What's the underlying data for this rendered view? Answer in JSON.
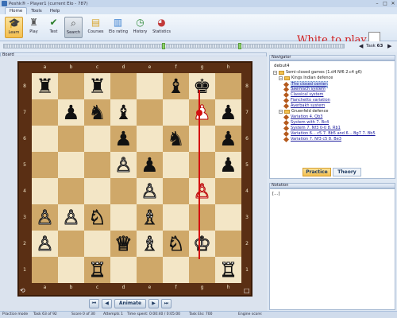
{
  "window": {
    "title": "Peshk® - Player1 (current Elo - 787)",
    "controls": [
      "–",
      "□",
      "✕"
    ]
  },
  "ribbon_tabs": [
    "Home",
    "Tools",
    "Help"
  ],
  "ribbon_buttons": [
    "Learn",
    "Play",
    "Test",
    "Search",
    "Courses",
    "Elo rating",
    "History",
    "Statistics"
  ],
  "turn_message": "White to play",
  "task": {
    "label": "Task",
    "number": "63"
  },
  "progress_nav": {
    "prev": "◀",
    "next": "▶"
  },
  "panels": {
    "board": "Board",
    "navigator": "Navigator",
    "notation": "Notation"
  },
  "board": {
    "files": [
      "a",
      "b",
      "c",
      "d",
      "e",
      "f",
      "g",
      "h"
    ],
    "ranks": [
      "8",
      "7",
      "6",
      "5",
      "4",
      "3",
      "2",
      "1"
    ],
    "pieces": [
      [
        "♜",
        "",
        "♜",
        "",
        "",
        "♝",
        "♚",
        ""
      ],
      [
        "",
        "♟",
        "♞",
        "♝",
        "",
        "",
        "♟",
        "♟"
      ],
      [
        "",
        "",
        "",
        "♟",
        "",
        "♞",
        "",
        "♟"
      ],
      [
        "",
        "",
        "",
        "♙",
        "♟",
        "",
        "",
        "♟"
      ],
      [
        "",
        "",
        "",
        "",
        "♙",
        "",
        "♙",
        ""
      ],
      [
        "♙",
        "♙",
        "♘",
        "",
        "♗",
        "",
        "",
        ""
      ],
      [
        "♙",
        "",
        "",
        "♕",
        "♗",
        "♘",
        "♔",
        ""
      ],
      [
        "",
        "",
        "♖",
        "",
        "",
        "",
        "",
        "♖"
      ]
    ],
    "colors": [
      [
        "b",
        "",
        "b",
        "",
        "",
        "b",
        "b",
        ""
      ],
      [
        "",
        "b",
        "b",
        "b",
        "",
        "",
        "hl",
        "b"
      ],
      [
        "",
        "",
        "",
        "b",
        "",
        "b",
        "",
        "b"
      ],
      [
        "",
        "",
        "",
        "w",
        "b",
        "",
        "",
        "b"
      ],
      [
        "",
        "",
        "",
        "",
        "w",
        "",
        "hl",
        ""
      ],
      [
        "w",
        "w",
        "w",
        "",
        "w",
        "",
        "",
        ""
      ],
      [
        "w",
        "",
        "",
        "w",
        "w",
        "w",
        "w",
        ""
      ],
      [
        "",
        "",
        "w",
        "",
        "",
        "",
        "",
        "w"
      ]
    ]
  },
  "controls": {
    "first": "⏮",
    "prev": "◀",
    "animate": "Animate",
    "next": "▶",
    "last": "⏭"
  },
  "navigator": {
    "root": "debut4",
    "items": [
      {
        "text": "Semi-closed games (1.d4 Nf6 2.c4 g6)",
        "kind": "folder",
        "toggle": "−"
      },
      {
        "text": "Kings Indian defence",
        "kind": "folder",
        "toggle": "−"
      },
      {
        "text": "The closed center",
        "kind": "leaf",
        "link": true,
        "selected": true
      },
      {
        "text": "Saemisch system",
        "kind": "leaf",
        "link": true
      },
      {
        "text": "Classical system",
        "kind": "leaf",
        "link": true
      },
      {
        "text": "Fianchetto variation",
        "kind": "leaf",
        "link": true
      },
      {
        "text": "Averbakh system",
        "kind": "leaf",
        "link": true
      },
      {
        "text": "Gruenfeld defence",
        "kind": "folder",
        "toggle": "−"
      },
      {
        "text": "Variation 4. Qb3",
        "kind": "leaf",
        "link": true
      },
      {
        "text": "System with 7. Bc4",
        "kind": "leaf",
        "link": true
      },
      {
        "text": "System 7. Nf3 0-0 8. Rb1",
        "kind": "leaf",
        "link": true
      },
      {
        "text": "Variation 6... c5 7. Bb5 and 6... Bg7 7. Bb5",
        "kind": "leaf",
        "link": true
      },
      {
        "text": "Variation 7. Nf3 c5 8. Be3",
        "kind": "leaf",
        "link": true
      }
    ]
  },
  "tabs": {
    "practice": "Practice",
    "theory": "Theory"
  },
  "notation": {
    "text": "[...]"
  },
  "status": {
    "mode": "Practice mode",
    "task": "Task 63 of 92",
    "score": "Score 0 of 30",
    "attempts": "Attempts 1",
    "time": "Time spent: 0:00:40 / 0:05:00",
    "elo": "Task Elo: 700",
    "engine": "Engine score:"
  }
}
